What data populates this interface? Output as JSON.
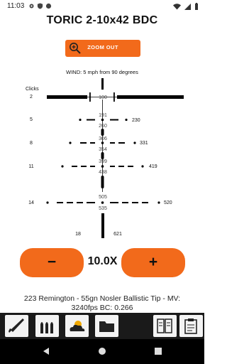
{
  "status_bar": {
    "time": "11:03",
    "icons": [
      "gear-icon",
      "shield-icon",
      "record-icon",
      "wifi-icon",
      "signal-icon",
      "battery-icon"
    ]
  },
  "title": "TORIC 2-10x42 BDC",
  "zoom_button": {
    "label": "ZOOM OUT",
    "icon": "zoom-in-icon"
  },
  "wind": "WIND: 5 mph from 90 degrees",
  "reticle": {
    "clicks_header": "Clicks",
    "rows": [
      {
        "clicks": "2",
        "upper_yardage": "100",
        "lower_yardage": "",
        "right_yardage": ""
      },
      {
        "clicks": "5",
        "upper_yardage": "191",
        "lower_yardage": "260",
        "right_yardage": "230"
      },
      {
        "clicks": "8",
        "upper_yardage": "306",
        "lower_yardage": "354",
        "right_yardage": "331"
      },
      {
        "clicks": "11",
        "upper_yardage": "399",
        "lower_yardage": "438",
        "right_yardage": "419"
      },
      {
        "clicks": "14",
        "upper_yardage": "505",
        "lower_yardage": "535",
        "right_yardage": "520"
      }
    ],
    "bottom_left": "18",
    "bottom_right": "621"
  },
  "controls": {
    "minus_label": "−",
    "plus_label": "+",
    "zoom_level": "10.0X"
  },
  "ammo": "223 Remington - 55gn Nosler Ballistic Tip - MV: 3240fps BC: 0.266",
  "toolbar": {
    "buttons": [
      "rifle-icon",
      "ammo-icon",
      "weather-icon",
      "folder-icon",
      "columns-icon",
      "clipboard-icon"
    ]
  },
  "navigation": [
    "back-icon",
    "home-icon",
    "recents-icon"
  ],
  "colors": {
    "accent": "#f26a1b",
    "toolbar_bg": "#1a1a1a",
    "nav_bg": "#000000"
  }
}
